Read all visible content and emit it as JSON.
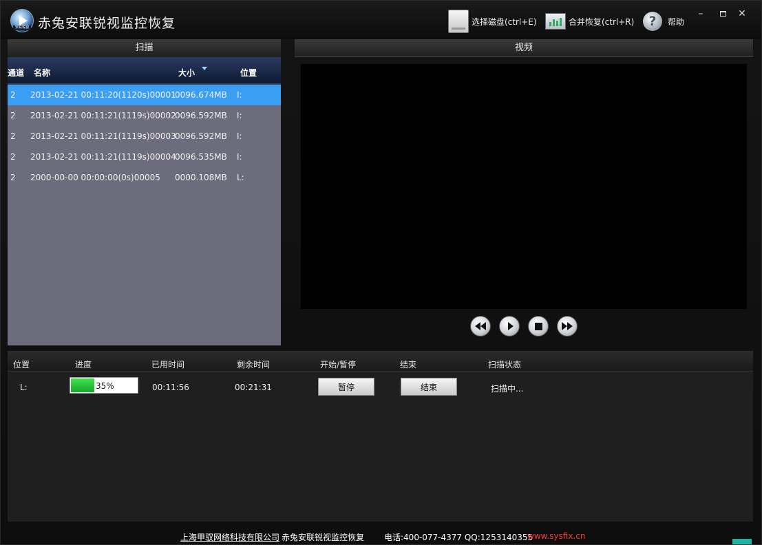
{
  "window": {
    "title": "赤兔安联锐视监控恢复",
    "logo_caption": "安联锐视",
    "controls": {
      "minimize": "–",
      "close": "✕"
    }
  },
  "toolbar": {
    "select_disk": "选择磁盘(ctrl+E)",
    "merge_recover": "合并恢复(ctrl+R)",
    "help": "帮助",
    "help_glyph": "?"
  },
  "scan": {
    "title": "扫描",
    "columns": [
      "通道",
      "名称",
      "大小",
      "位置"
    ],
    "rows": [
      {
        "channel": "2",
        "name": "2013-02-21 00:11:20(1120s)00001",
        "size": "0096.674MB",
        "location": "I:",
        "selected": true
      },
      {
        "channel": "2",
        "name": "2013-02-21 00:11:21(1119s)00002",
        "size": "0096.592MB",
        "location": "I:"
      },
      {
        "channel": "2",
        "name": "2013-02-21 00:11:21(1119s)00003",
        "size": "0096.592MB",
        "location": "I:"
      },
      {
        "channel": "2",
        "name": "2013-02-21 00:11:21(1119s)00004",
        "size": "0096.535MB",
        "location": "I:"
      },
      {
        "channel": "2",
        "name": "2000-00-00 00:00:00(0s)00005",
        "size": "0000.108MB",
        "location": "L:"
      }
    ]
  },
  "video": {
    "title": "视频"
  },
  "status": {
    "columns": [
      "位置",
      "进度",
      "已用时间",
      "剩余时间",
      "开始/暂停",
      "结束",
      "扫描状态"
    ],
    "location": "L:",
    "progress_percent": 35,
    "progress_label": "35%",
    "elapsed": "00:11:56",
    "remaining": "00:21:31",
    "pause_label": "暂停",
    "end_label": "结束",
    "scan_state": "扫描中..."
  },
  "footer": {
    "company": "上海甲驭网络科技有限公司",
    "product": "赤兔安联锐视监控恢复",
    "phone": "电话:400-077-4377 QQ:1253140355",
    "site": "www.sysfix.cn"
  },
  "colors": {
    "selected_row": "#3a9ff2",
    "table_bg": "#6c6c7d",
    "progress_fill": "#22c036",
    "footer_link": "#ff3a3a"
  }
}
